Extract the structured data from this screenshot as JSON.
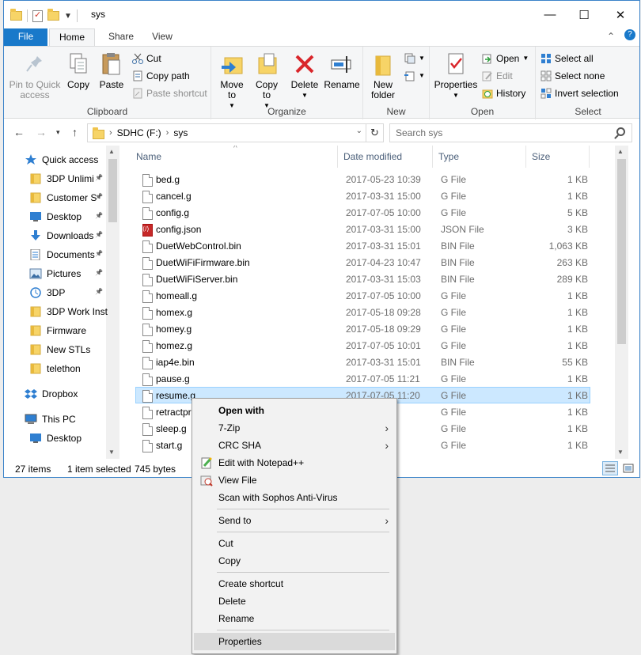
{
  "window": {
    "title": "sys",
    "controls": {
      "minimize": "—",
      "maximize": "☐",
      "close": "✕"
    }
  },
  "tabs": {
    "file": "File",
    "home": "Home",
    "share": "Share",
    "view": "View"
  },
  "ribbon": {
    "clipboard": {
      "label": "Clipboard",
      "pin": "Pin to Quick access",
      "copy": "Copy",
      "paste": "Paste",
      "cut": "Cut",
      "copy_path": "Copy path",
      "paste_shortcut": "Paste shortcut"
    },
    "organize": {
      "label": "Organize",
      "move_to": "Move to",
      "copy_to": "Copy to",
      "delete": "Delete",
      "rename": "Rename"
    },
    "new": {
      "label": "New",
      "new_folder": "New folder"
    },
    "open": {
      "label": "Open",
      "properties": "Properties",
      "open": "Open",
      "edit": "Edit",
      "history": "History"
    },
    "select": {
      "label": "Select",
      "select_all": "Select all",
      "select_none": "Select none",
      "invert": "Invert selection"
    }
  },
  "address": {
    "crumbs": [
      "SDHC (F:)",
      "sys"
    ],
    "search_placeholder": "Search sys"
  },
  "navpane": [
    {
      "label": "Quick access",
      "icon": "star-icon",
      "indent": 1,
      "pinned": false
    },
    {
      "label": "3DP Unlimi",
      "icon": "folder-icon",
      "indent": 2,
      "pinned": true
    },
    {
      "label": "Customer S",
      "icon": "folder-icon",
      "indent": 2,
      "pinned": true
    },
    {
      "label": "Desktop",
      "icon": "desktop-icon",
      "indent": 2,
      "pinned": true
    },
    {
      "label": "Downloads",
      "icon": "download-icon",
      "indent": 2,
      "pinned": true
    },
    {
      "label": "Documents",
      "icon": "documents-icon",
      "indent": 2,
      "pinned": true
    },
    {
      "label": "Pictures",
      "icon": "pictures-icon",
      "indent": 2,
      "pinned": true
    },
    {
      "label": "3DP",
      "icon": "sync-folder-icon",
      "indent": 2,
      "pinned": true
    },
    {
      "label": "3DP Work Inst",
      "icon": "folder-icon",
      "indent": 2,
      "pinned": false
    },
    {
      "label": "Firmware",
      "icon": "folder-icon",
      "indent": 2,
      "pinned": false
    },
    {
      "label": "New STLs",
      "icon": "folder-icon",
      "indent": 2,
      "pinned": false
    },
    {
      "label": "telethon",
      "icon": "folder-icon",
      "indent": 2,
      "pinned": false
    },
    {
      "label": "Dropbox",
      "icon": "dropbox-icon",
      "indent": 1,
      "pinned": false
    },
    {
      "label": "This PC",
      "icon": "computer-icon",
      "indent": 1,
      "pinned": false
    },
    {
      "label": "Desktop",
      "icon": "desktop-icon",
      "indent": 2,
      "pinned": false
    }
  ],
  "columns": {
    "name": "Name",
    "date": "Date modified",
    "type": "Type",
    "size": "Size"
  },
  "files": [
    {
      "name": "bed.g",
      "date": "2017-05-23 10:39",
      "type": "G File",
      "size": "1 KB"
    },
    {
      "name": "cancel.g",
      "date": "2017-03-31 15:00",
      "type": "G File",
      "size": "1 KB"
    },
    {
      "name": "config.g",
      "date": "2017-07-05 10:00",
      "type": "G File",
      "size": "5 KB"
    },
    {
      "name": "config.json",
      "date": "2017-03-31 15:00",
      "type": "JSON File",
      "size": "3 KB"
    },
    {
      "name": "DuetWebControl.bin",
      "date": "2017-03-31 15:01",
      "type": "BIN File",
      "size": "1,063 KB"
    },
    {
      "name": "DuetWiFiFirmware.bin",
      "date": "2017-04-23 10:47",
      "type": "BIN File",
      "size": "263 KB"
    },
    {
      "name": "DuetWiFiServer.bin",
      "date": "2017-03-31 15:03",
      "type": "BIN File",
      "size": "289 KB"
    },
    {
      "name": "homeall.g",
      "date": "2017-07-05 10:00",
      "type": "G File",
      "size": "1 KB"
    },
    {
      "name": "homex.g",
      "date": "2017-05-18 09:28",
      "type": "G File",
      "size": "1 KB"
    },
    {
      "name": "homey.g",
      "date": "2017-05-18 09:29",
      "type": "G File",
      "size": "1 KB"
    },
    {
      "name": "homez.g",
      "date": "2017-07-05 10:01",
      "type": "G File",
      "size": "1 KB"
    },
    {
      "name": "iap4e.bin",
      "date": "2017-03-31 15:01",
      "type": "BIN File",
      "size": "55 KB"
    },
    {
      "name": "pause.g",
      "date": "2017-07-05 11:21",
      "type": "G File",
      "size": "1 KB"
    },
    {
      "name": "resume.g",
      "date": "2017-07-05 11:20",
      "type": "G File",
      "size": "1 KB",
      "selected": true
    },
    {
      "name": "retractprc",
      "date": ":01",
      "type": "G File",
      "size": "1 KB"
    },
    {
      "name": "sleep.g",
      "date": ":01",
      "type": "G File",
      "size": "1 KB"
    },
    {
      "name": "start.g",
      "date": ":21",
      "type": "G File",
      "size": "1 KB"
    }
  ],
  "status": {
    "count": "27 items",
    "selected": "1 item selected",
    "size": "745 bytes"
  },
  "context_menu": [
    {
      "label": "Open with",
      "bold": true,
      "submenu": false
    },
    {
      "label": "7-Zip",
      "submenu": true
    },
    {
      "label": "CRC SHA",
      "submenu": true
    },
    {
      "label": "Edit with Notepad++",
      "icon": "notepad-icon"
    },
    {
      "label": "View File",
      "icon": "viewfile-icon"
    },
    {
      "label": "Scan with Sophos Anti-Virus"
    },
    {
      "separator": true
    },
    {
      "label": "Send to",
      "submenu": true
    },
    {
      "separator": true
    },
    {
      "label": "Cut"
    },
    {
      "label": "Copy"
    },
    {
      "separator": true
    },
    {
      "label": "Create shortcut"
    },
    {
      "label": "Delete"
    },
    {
      "label": "Rename"
    },
    {
      "separator": true
    },
    {
      "label": "Properties",
      "highlighted": true
    }
  ],
  "colors": {
    "accent": "#1979ca",
    "selection": "#cce8ff",
    "folder": "#f7d467"
  }
}
